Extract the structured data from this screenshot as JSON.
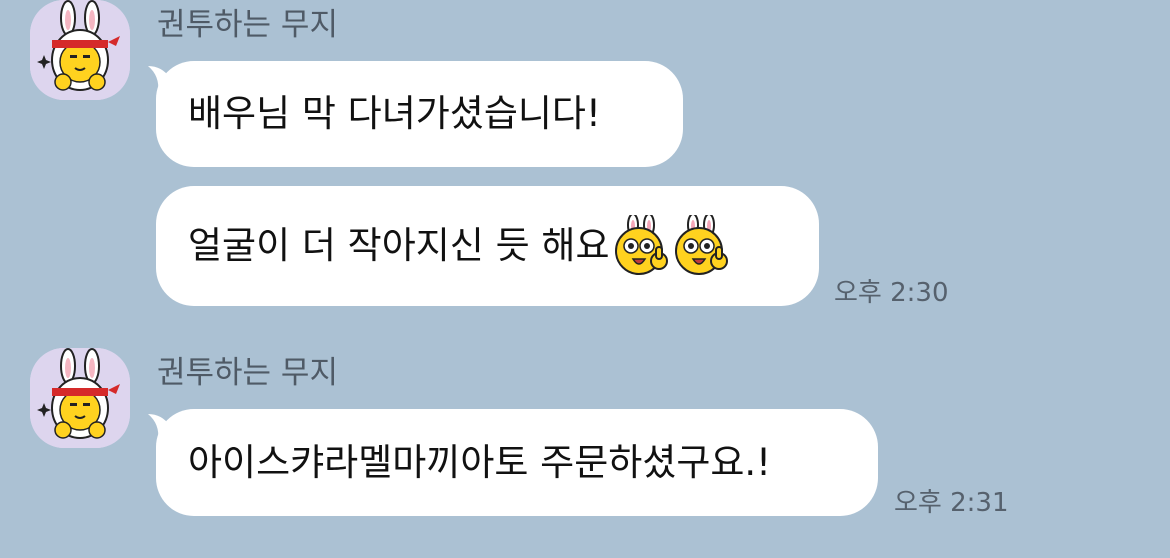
{
  "chat": {
    "background": "#abc1d3",
    "bubble_color": "#ffffff",
    "groups": [
      {
        "sender": "권투하는 무지",
        "messages": [
          {
            "text": "배우님 막 다녀가셨습니다!",
            "time": ""
          },
          {
            "text": "얼굴이 더 작아지신 듯 해요",
            "emojis": [
              "muzi-thumbs-up-emoji",
              "muzi-thumbs-up-emoji"
            ],
            "time": "오후 2:30"
          }
        ]
      },
      {
        "sender": "권투하는 무지",
        "messages": [
          {
            "text": "아이스캬라멜마끼아토 주문하셨구요.!",
            "time": "오후 2:31"
          }
        ]
      }
    ]
  }
}
